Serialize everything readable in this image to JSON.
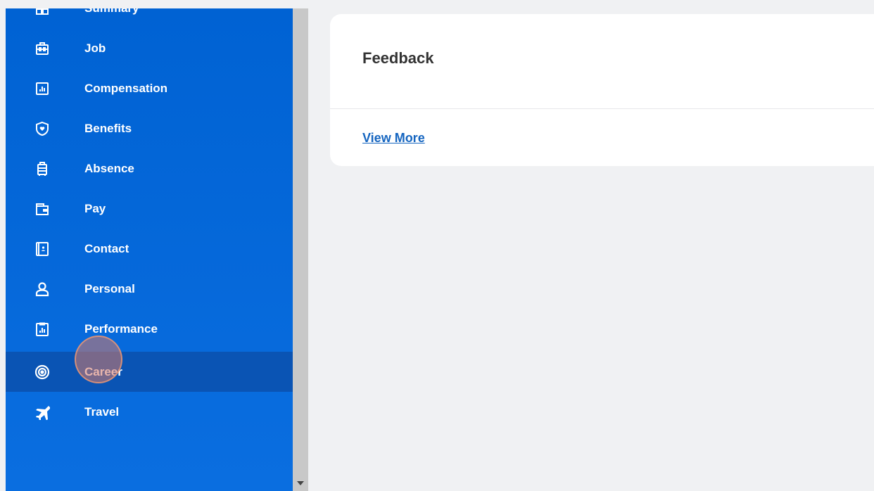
{
  "sidebar": {
    "items": [
      {
        "label": "Summary",
        "icon": "grid-icon"
      },
      {
        "label": "Job",
        "icon": "briefcase-icon"
      },
      {
        "label": "Compensation",
        "icon": "bar-chart-icon"
      },
      {
        "label": "Benefits",
        "icon": "shield-heart-icon"
      },
      {
        "label": "Absence",
        "icon": "luggage-icon"
      },
      {
        "label": "Pay",
        "icon": "wallet-icon"
      },
      {
        "label": "Contact",
        "icon": "contact-book-icon"
      },
      {
        "label": "Personal",
        "icon": "person-icon"
      },
      {
        "label": "Performance",
        "icon": "clipboard-chart-icon"
      },
      {
        "label": "Career",
        "icon": "target-icon"
      },
      {
        "label": "Travel",
        "icon": "airplane-icon"
      }
    ],
    "active_index": 9
  },
  "card": {
    "title": "Feedback",
    "link": "View More"
  },
  "colors": {
    "sidebar_bg": "#0062d3",
    "sidebar_active": "#0a54b4",
    "link": "#1565c0",
    "page_bg": "#f0f1f3"
  }
}
